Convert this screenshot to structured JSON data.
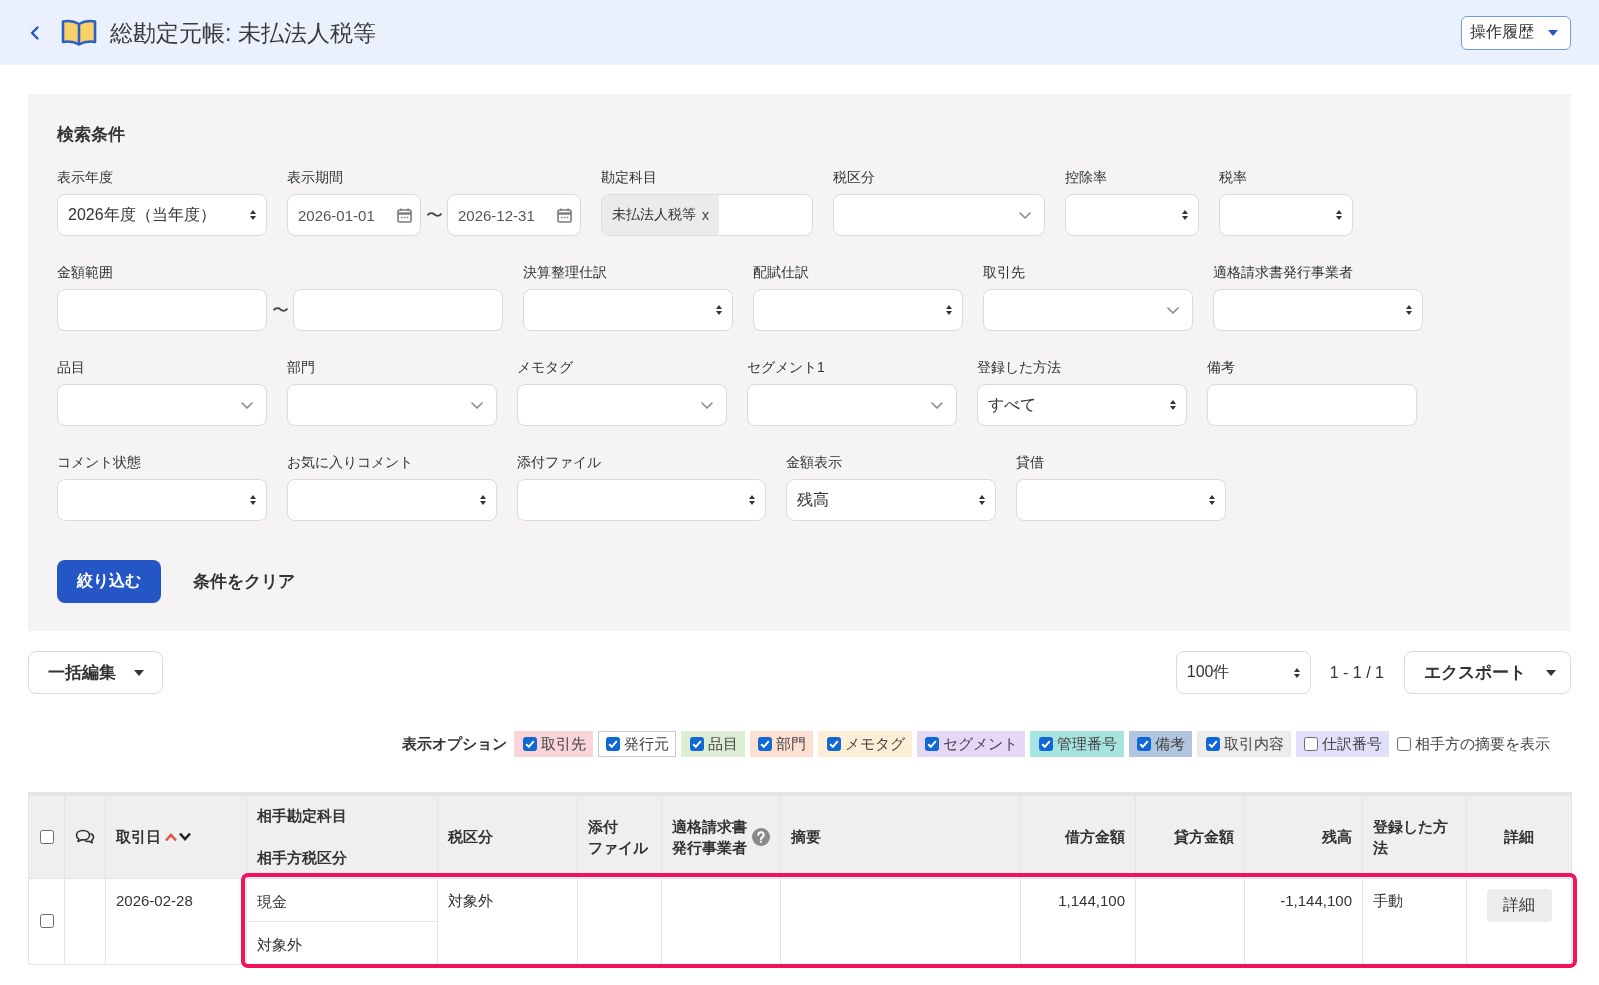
{
  "header": {
    "title": "総勘定元帳: 未払法人税等",
    "history_button": "操作履歴"
  },
  "search": {
    "title": "検索条件",
    "fields": [
      {
        "label": "表示年度",
        "kind": "select",
        "value": "2026年度（当年度）"
      },
      {
        "label": "表示期間",
        "kind": "date_range",
        "from": "2026-01-01",
        "separator": "〜",
        "to": "2026-12-31"
      },
      {
        "label": "勘定科目",
        "kind": "tags",
        "tags": [
          {
            "label": "未払法人税等",
            "remove": "x"
          }
        ]
      },
      {
        "label": "税区分",
        "kind": "dropdown"
      },
      {
        "label": "控除率",
        "kind": "select"
      },
      {
        "label": "税率",
        "kind": "select"
      },
      {
        "label": "金額範囲",
        "kind": "range",
        "separator": "〜"
      },
      {
        "label": "決算整理仕訳",
        "kind": "select"
      },
      {
        "label": "配賦仕訳",
        "kind": "select"
      },
      {
        "label": "取引先",
        "kind": "dropdown"
      },
      {
        "label": "適格請求書発行事業者",
        "kind": "select"
      },
      {
        "label": "品目",
        "kind": "dropdown"
      },
      {
        "label": "部門",
        "kind": "dropdown"
      },
      {
        "label": "メモタグ",
        "kind": "dropdown"
      },
      {
        "label": "セグメント1",
        "kind": "dropdown"
      },
      {
        "label": "登録した方法",
        "kind": "select",
        "value": "すべて"
      },
      {
        "label": "備考",
        "kind": "text"
      },
      {
        "label": "コメント状態",
        "kind": "select"
      },
      {
        "label": "お気に入りコメント",
        "kind": "select"
      },
      {
        "label": "添付ファイル",
        "kind": "select"
      },
      {
        "label": "金額表示",
        "kind": "select",
        "value": "残高"
      },
      {
        "label": "貸借",
        "kind": "select"
      }
    ],
    "submit_button": "絞り込む",
    "clear_button": "条件をクリア"
  },
  "toolbar": {
    "bulk_edit": "一括編集",
    "per_page": "100件",
    "range": "1 - 1 / 1",
    "export": "エクスポート"
  },
  "display_options": {
    "label": "表示オプション",
    "items": [
      {
        "label": "取引先",
        "kind": "filled",
        "checked": true,
        "color": "#f9d4d8"
      },
      {
        "label": "発行元",
        "kind": "outlined",
        "checked": true,
        "color": "#ffffff"
      },
      {
        "label": "品目",
        "kind": "filled",
        "checked": true,
        "color": "#ddeed4"
      },
      {
        "label": "部門",
        "kind": "filled",
        "checked": true,
        "color": "#fde0d2"
      },
      {
        "label": "メモタグ",
        "kind": "filled",
        "checked": true,
        "color": "#fdefd5"
      },
      {
        "label": "セグメント",
        "kind": "filled",
        "checked": true,
        "color": "#e5d8f7"
      },
      {
        "label": "管理番号",
        "kind": "filled",
        "checked": true,
        "color": "#a7e4e0"
      },
      {
        "label": "備考",
        "kind": "filled",
        "checked": true,
        "color": "#b2c5df"
      },
      {
        "label": "取引内容",
        "kind": "filled",
        "checked": true,
        "color": "#ececec"
      },
      {
        "label": "仕訳番号",
        "kind": "filled",
        "checked": false,
        "color": "#e1e0fb"
      },
      {
        "label": "相手方の摘要を表示",
        "kind": "plain",
        "checked": false
      }
    ]
  },
  "table": {
    "columns": [
      {
        "kind": "checkbox",
        "checked": false
      },
      {
        "kind": "comments"
      },
      {
        "kind": "sortable",
        "label": "取引日",
        "sorted_ascending": true
      },
      {
        "kind": "stacked",
        "labels": [
          "相手勘定科目",
          "相手方税区分"
        ]
      },
      {
        "kind": "text",
        "label": "税区分"
      },
      {
        "kind": "text",
        "label": "添付ファイル"
      },
      {
        "kind": "help",
        "label": "適格請求書発行事業者"
      },
      {
        "kind": "text",
        "label": "摘要"
      },
      {
        "kind": "amount",
        "label": "借方金額"
      },
      {
        "kind": "amount",
        "label": "貸方金額"
      },
      {
        "kind": "amount",
        "label": "残高"
      },
      {
        "kind": "text",
        "label": "登録した方法"
      },
      {
        "kind": "action",
        "label": "詳細"
      }
    ],
    "rows": [
      {
        "highlighted": true,
        "cells": [
          {
            "checked": false
          },
          {},
          {
            "text": "2026-02-28"
          },
          {
            "lines": [
              "現金",
              "対象外"
            ]
          },
          {
            "text": "対象外"
          },
          {},
          {},
          {},
          {
            "text": "1,144,100"
          },
          {},
          {
            "text": "-1,144,100"
          },
          {
            "text": "手動"
          },
          {
            "button": "詳細"
          }
        ]
      }
    ]
  }
}
